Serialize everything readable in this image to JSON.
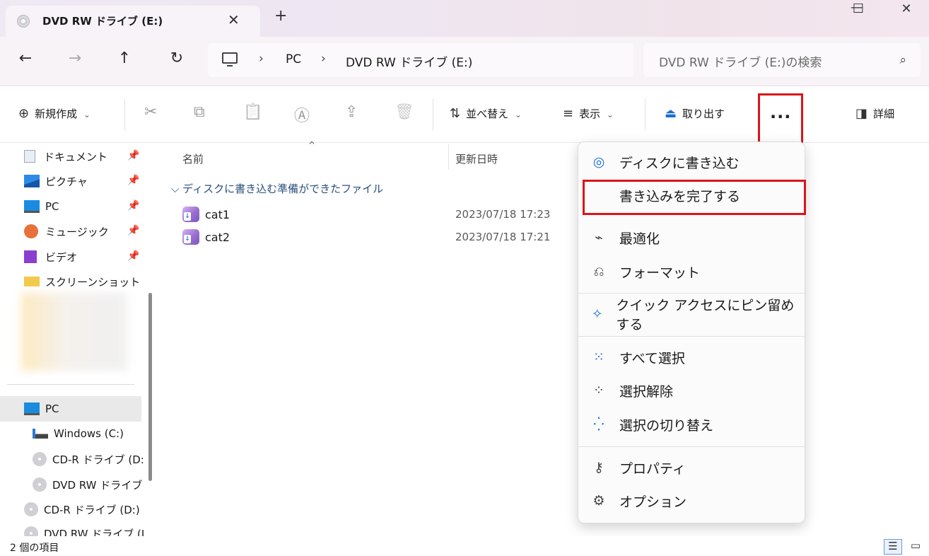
{
  "window": {
    "tab_title": "DVD RW ドライブ (E:)",
    "tab_close": "✕",
    "new_tab": "+",
    "minimize": "—",
    "maximize": "☐",
    "close": "✕"
  },
  "nav": {
    "back": "←",
    "forward": "→",
    "up": "↑",
    "refresh": "↻"
  },
  "address": {
    "separator": "›",
    "crumbs": [
      "PC",
      "DVD RW ドライブ (E:)"
    ]
  },
  "search": {
    "placeholder": "DVD RW ドライブ (E:)の検索",
    "icon": "⌕"
  },
  "toolbar": {
    "new_label": "新規作成",
    "new_icon": "⊕",
    "sort_label": "並べ替え",
    "sort_icon": "⇅",
    "view_label": "表示",
    "view_icon": "≡",
    "eject_label": "取り出す",
    "eject_icon": "⏏",
    "more_label": "···",
    "details_label": "詳細",
    "details_icon": "◨",
    "chevron": "⌄",
    "icons": {
      "cut": "✂",
      "copy": "⧉",
      "paste": "📋",
      "rename": "Ⓐ",
      "share": "⇪",
      "delete": "🗑"
    }
  },
  "sidebar": {
    "pin_icon": "📌",
    "quick_access": [
      {
        "label": "ドキュメント"
      },
      {
        "label": "ピクチャ"
      },
      {
        "label": "PC"
      },
      {
        "label": "ミュージック"
      },
      {
        "label": "ビデオ"
      },
      {
        "label": "スクリーンショット"
      }
    ],
    "this_pc": "PC",
    "drives": [
      "Windows (C:)",
      "CD-R ドライブ (D:",
      "DVD RW ドライブ"
    ],
    "more": [
      "CD-R ドライブ (D:)",
      "DVD RW ドライブ (I"
    ]
  },
  "files": {
    "col_name": "名前",
    "col_date": "更新日時",
    "sort_caret": "^",
    "group_label": "⌵ ディスクに書き込む準備ができたファイル",
    "rows": [
      {
        "name": "cat1",
        "date": "2023/07/18 17:23"
      },
      {
        "name": "cat2",
        "date": "2023/07/18 17:21"
      }
    ]
  },
  "menu": {
    "burn": "ディスクに書き込む",
    "finish_burn": "書き込みを完了する",
    "optimize": "最適化",
    "format": "フォーマット",
    "pin_quick": "クイック アクセスにピン留めする",
    "select_all": "すべて選択",
    "select_none": "選択解除",
    "invert": "選択の切り替え",
    "properties": "プロパティ",
    "options": "オプション",
    "icons": {
      "burn": "◎",
      "optimize": "⌁",
      "format": "⎌",
      "pin": "✧",
      "select_all": "⁙",
      "select_none": "⁘",
      "invert": "⁛",
      "properties": "⚷",
      "options": "⚙"
    }
  },
  "status": {
    "count": "2 個の項目",
    "details_view": "☰",
    "tiles_view": "▭"
  },
  "colors": {
    "highlight_red": "#d9161b",
    "folder_yellow": "#f2c94c",
    "pc_blue": "#1b8be0",
    "group_blue": "#2a4f7a"
  }
}
